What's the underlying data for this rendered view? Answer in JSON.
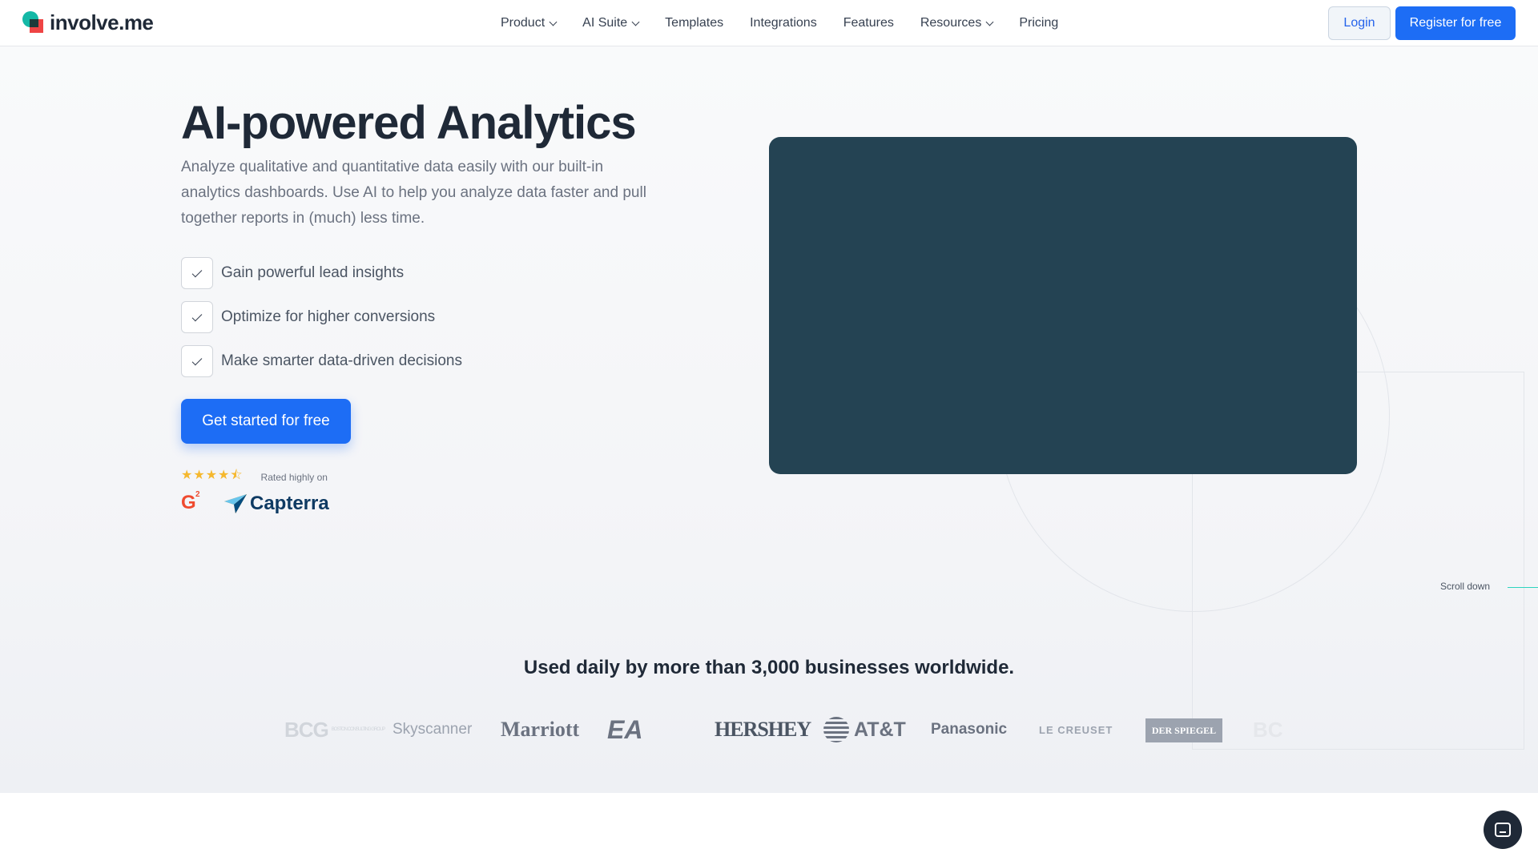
{
  "brand": {
    "logo_text": "involve.me",
    "accent": "#1d6df5",
    "teal": "#14b8a6",
    "red": "#ef4444"
  },
  "nav": {
    "items": [
      {
        "label": "Product",
        "dropdown": true
      },
      {
        "label": "AI Suite",
        "dropdown": true
      },
      {
        "label": "Templates",
        "dropdown": false
      },
      {
        "label": "Integrations",
        "dropdown": false
      },
      {
        "label": "Features",
        "dropdown": false
      },
      {
        "label": "Resources",
        "dropdown": true
      },
      {
        "label": "Pricing",
        "dropdown": false
      }
    ],
    "login_label": "Login",
    "register_label": "Register for free"
  },
  "hero": {
    "title": "AI-powered Analytics",
    "description": "Analyze qualitative and quantitative data easily with our built-in analytics dashboards. Use AI to help you analyze data faster and pull together reports in (much) less time.",
    "checklist": [
      "Gain powerful lead insights",
      "Optimize for higher conversions",
      "Make smarter data-driven decisions"
    ],
    "cta_label": "Get started for free",
    "rating_stars": "★★★★⯪",
    "rated_text": "Rated highly on",
    "review_sites": {
      "g2": "G",
      "g2_sup": "2",
      "capterra": "Capterra"
    },
    "media_color": "#244353"
  },
  "scroll_label": "Scroll down",
  "social_proof": {
    "headline": "Used daily by more than 3,000 businesses worldwide.",
    "logos": [
      "BCG",
      "BOSTON CONSULTING GROUP",
      "Skyscanner",
      "Marriott",
      "EA",
      "HERSHEY",
      "AT&T",
      "Panasonic",
      "LE CREUSET",
      "DER SPIEGEL",
      "BC"
    ]
  }
}
